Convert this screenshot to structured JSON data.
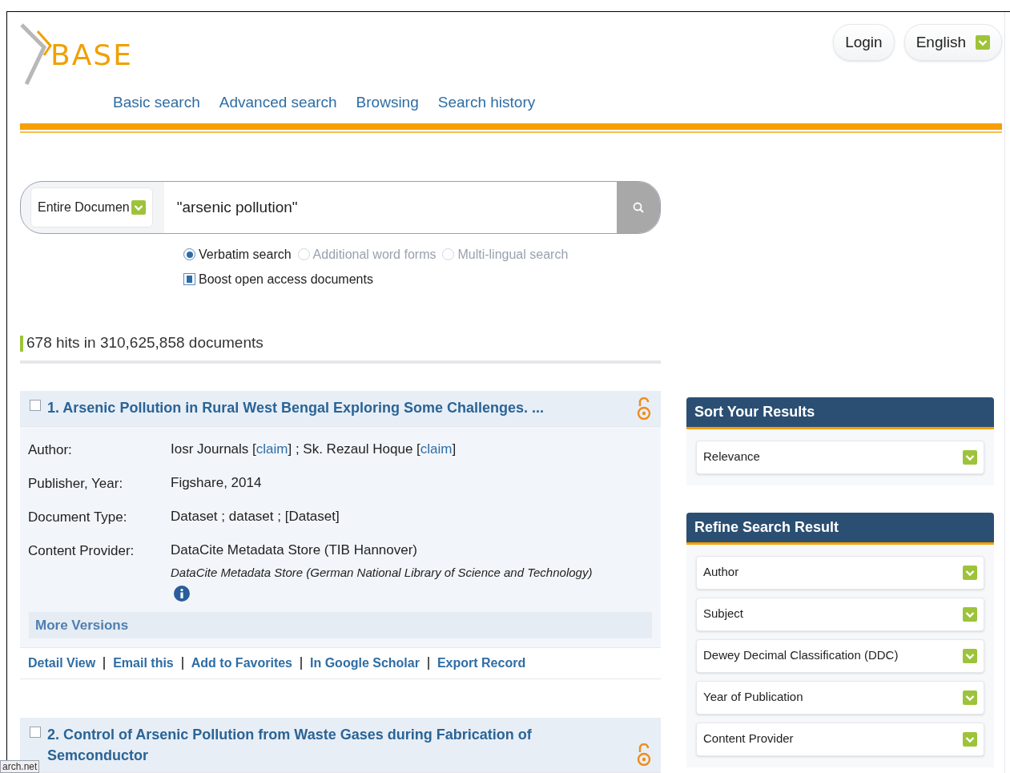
{
  "logo": {
    "text": "BASE"
  },
  "header_buttons": [
    {
      "kind": "plain",
      "label": "Login"
    },
    {
      "kind": "dropdown",
      "label": "English"
    }
  ],
  "nav": [
    {
      "label": "Basic search"
    },
    {
      "label": "Advanced search"
    },
    {
      "label": "Browsing"
    },
    {
      "label": "Search history"
    }
  ],
  "search": {
    "scope": "Entire Documen",
    "query": "\"arsenic pollution\""
  },
  "search_modes": [
    {
      "label": "Verbatim search",
      "selected": true
    },
    {
      "label": "Additional word forms",
      "selected": false
    },
    {
      "label": "Multi-lingual search",
      "selected": false
    }
  ],
  "boost": {
    "label": "Boost open access documents",
    "checked": true
  },
  "hits": "678 hits in 310,625,858 documents",
  "results": [
    {
      "title": "1. Arsenic Pollution in Rural West Bengal Exploring Some Challenges. ...",
      "checked": false,
      "open_access": true,
      "fields": [
        {
          "label": "Author:",
          "lines": [
            [
              {
                "text": "Iosr Journals ["
              },
              {
                "text": "claim",
                "kind": "link"
              },
              {
                "text": "] ; Sk. Rezaul Hoque ["
              },
              {
                "text": "claim",
                "kind": "link"
              },
              {
                "text": "]"
              }
            ]
          ]
        },
        {
          "label": "Publisher, Year:",
          "lines": [
            [
              {
                "text": "Figshare, 2014"
              }
            ]
          ]
        },
        {
          "label": "Document Type:",
          "lines": [
            [
              {
                "text": "Dataset ; dataset ; [Dataset]"
              }
            ]
          ]
        },
        {
          "label": "Content Provider:",
          "lines": [
            [
              {
                "text": "DataCite Metadata Store (TIB Hannover)"
              }
            ],
            [
              {
                "text": "DataCite Metadata Store (German National Library of Science and Technology)",
                "kind": "italic"
              }
            ]
          ],
          "info": true
        }
      ],
      "more_versions": "More Versions",
      "actions": [
        "Detail View",
        "Email this",
        "Add to Favorites",
        "In Google Scholar",
        "Export Record"
      ]
    },
    {
      "title": "2. Control of Arsenic Pollution from Waste Gases during Fabrication of Semconductor",
      "checked": false,
      "open_access": true
    }
  ],
  "sidebar": {
    "sort": {
      "title": "Sort Your Results",
      "value": "Relevance"
    },
    "refine": {
      "title": "Refine Search Result",
      "facets": [
        "Author",
        "Subject",
        "Dewey Decimal Classification (DDC)",
        "Year of Publication",
        "Content Provider"
      ]
    }
  },
  "status_tooltip": "arch.net"
}
